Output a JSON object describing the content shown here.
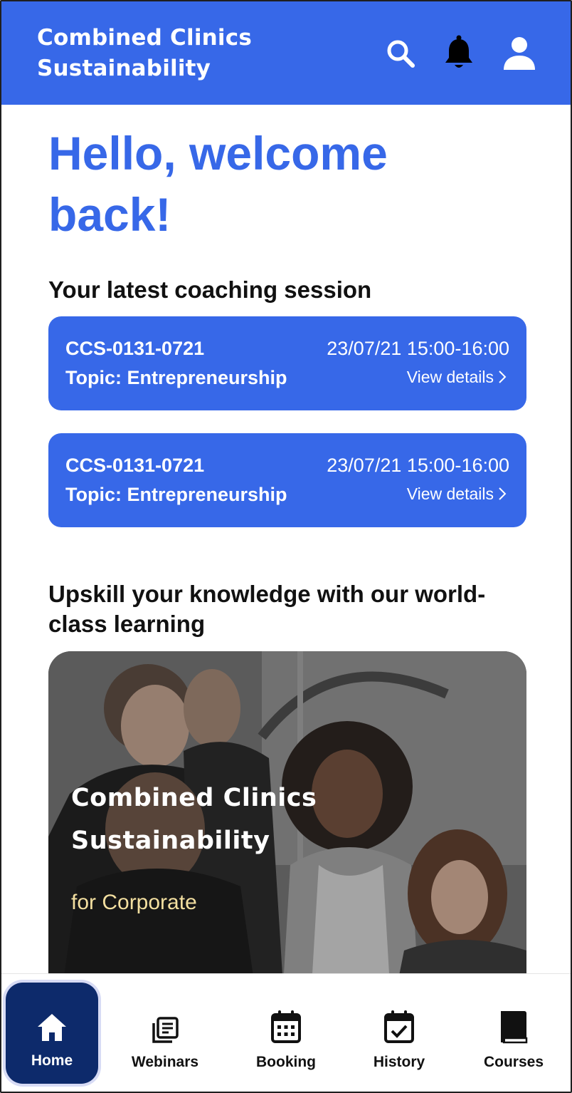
{
  "header": {
    "brand_line1": "Combined Clinics",
    "brand_line2": "Sustainability",
    "icons": [
      "search-icon",
      "bell-icon",
      "user-icon"
    ],
    "background": "#3768e8"
  },
  "greeting": {
    "line1": "Hello, welcome",
    "line2": "back!"
  },
  "sessions": {
    "title": "Your latest coaching session",
    "items": [
      {
        "code": "CCS-0131-0721",
        "datetime": "23/07/21 15:00-16:00",
        "topic": "Topic: Entrepreneurship",
        "details_label": "View details"
      },
      {
        "code": "CCS-0131-0721",
        "datetime": "23/07/21 15:00-16:00",
        "topic": "Topic: Entrepreneurship",
        "details_label": "View details"
      }
    ]
  },
  "learning": {
    "title": "Upskill your knowledge with our world-class learning",
    "banner": {
      "title_line1": "Combined Clinics",
      "title_line2": "Sustainability",
      "subtitle": "for Corporate"
    }
  },
  "bottom_nav": {
    "items": [
      {
        "label": "Home",
        "icon": "home-icon",
        "active": true
      },
      {
        "label": "Webinars",
        "icon": "webinars-icon",
        "active": false
      },
      {
        "label": "Booking",
        "icon": "calendar-icon",
        "active": false
      },
      {
        "label": "History",
        "icon": "calendar-check-icon",
        "active": false
      },
      {
        "label": "Courses",
        "icon": "book-icon",
        "active": false
      }
    ]
  },
  "colors": {
    "primary": "#3768e8",
    "nav_active": "#0d2a6b",
    "banner_subtitle": "#f3dfa0"
  }
}
